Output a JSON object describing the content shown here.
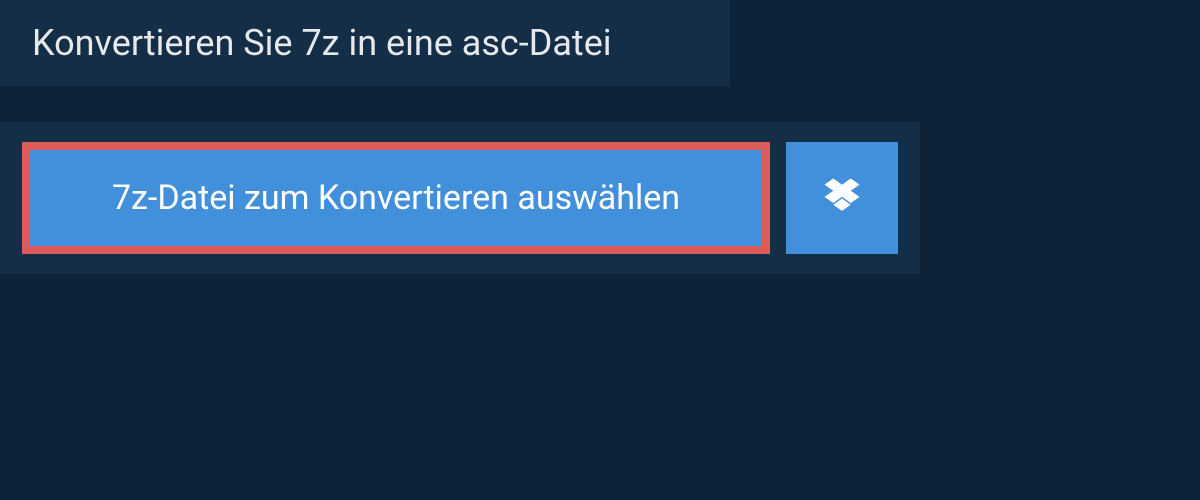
{
  "header": {
    "title": "Konvertieren Sie 7z in eine asc-Datei"
  },
  "upload": {
    "select_label": "7z-Datei zum Konvertieren auswählen"
  },
  "icons": {
    "dropbox": "dropbox-icon"
  },
  "colors": {
    "background": "#0e2338",
    "panel": "#142e48",
    "button": "#4290db",
    "highlight_border": "#dc5a57",
    "text_primary": "#e6e9ec",
    "text_button": "#ffffff"
  }
}
